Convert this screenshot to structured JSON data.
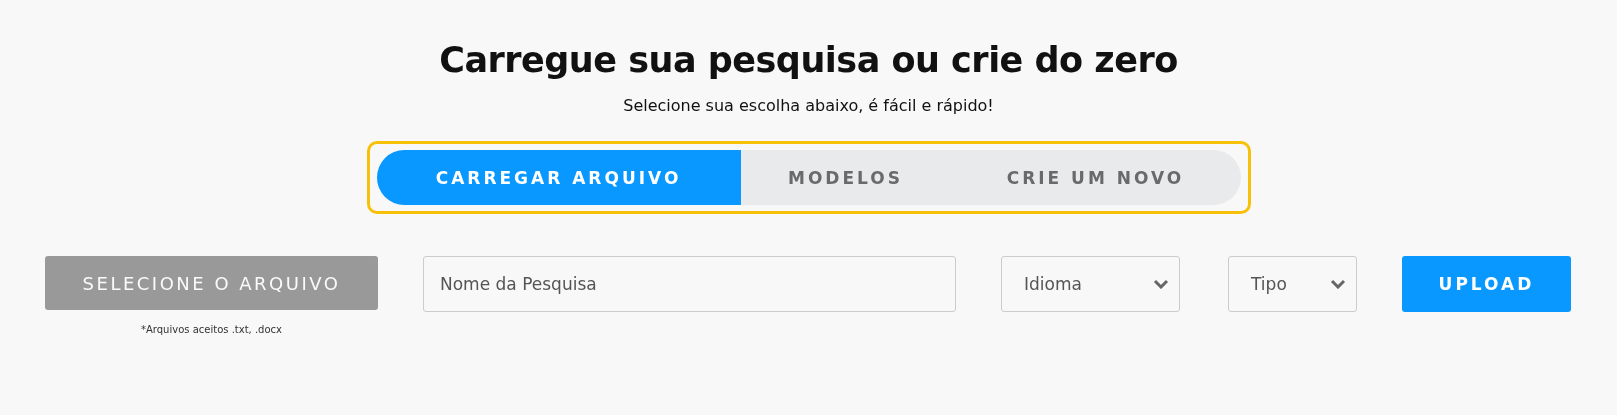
{
  "title": "Carregue sua pesquisa ou crie do zero",
  "subtitle": "Selecione sua escolha abaixo, é fácil e rápido!",
  "tabs": [
    {
      "label": "CARREGAR ARQUIVO",
      "selected": true
    },
    {
      "label": "MODELOS",
      "selected": false
    },
    {
      "label": "CRIE UM NOVO",
      "selected": false
    }
  ],
  "file_button": {
    "label": "SELECIONE O ARQUIVO",
    "disabled": true
  },
  "file_note": "*Arquivos aceitos .txt, .docx",
  "name_field": {
    "placeholder": "Nome da Pesquisa"
  },
  "selects": [
    {
      "value": "Idioma"
    },
    {
      "value": "Tipo"
    }
  ],
  "upload_button": {
    "label": "UPLOAD"
  }
}
